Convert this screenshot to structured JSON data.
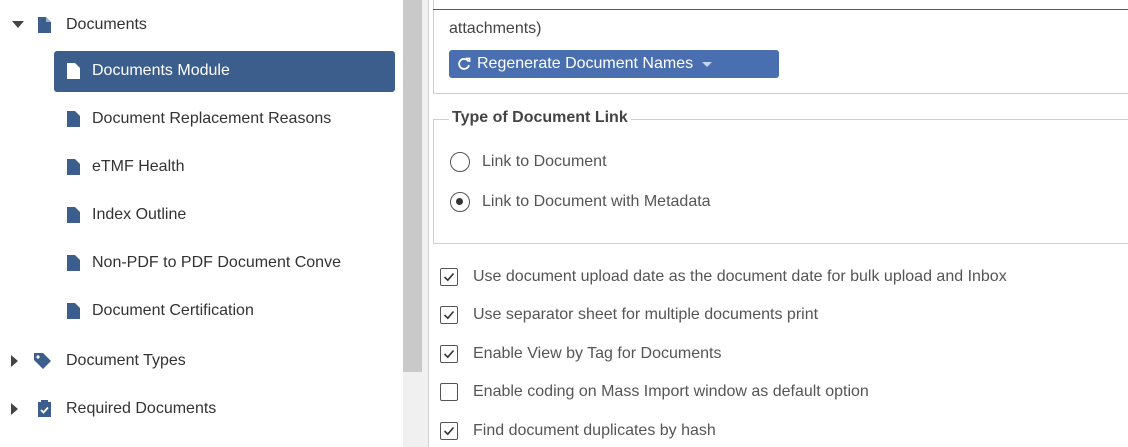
{
  "sidebar": {
    "items": [
      {
        "label": "Documents",
        "level": 0,
        "expanded": true
      },
      {
        "label": "Documents Module",
        "level": 1,
        "selected": true
      },
      {
        "label": "Document Replacement Reasons",
        "level": 1
      },
      {
        "label": "eTMF Health",
        "level": 1
      },
      {
        "label": "Index Outline",
        "level": 1
      },
      {
        "label": "Non-PDF to PDF Document Conve",
        "level": 1
      },
      {
        "label": "Document Certification",
        "level": 1
      },
      {
        "label": "Document Types",
        "level": 0,
        "expanded": false
      },
      {
        "label": "Required Documents",
        "level": 0,
        "expanded": false
      }
    ]
  },
  "main": {
    "attachments_text": "attachments)",
    "regenerate_button": "Regenerate Document Names",
    "document_link": {
      "legend": "Type of Document Link",
      "options": [
        {
          "label": "Link to Document",
          "selected": false
        },
        {
          "label": "Link to Document with Metadata",
          "selected": true
        }
      ]
    },
    "options": [
      {
        "label": "Use document upload date as the document date for bulk upload and Inbox",
        "checked": true
      },
      {
        "label": "Use separator sheet for multiple documents print",
        "checked": true
      },
      {
        "label": "Enable View by Tag for Documents",
        "checked": true
      },
      {
        "label": "Enable coding on Mass Import window as default option",
        "checked": false
      },
      {
        "label": "Find document duplicates by hash",
        "checked": true
      }
    ]
  },
  "colors": {
    "accent": "#3b5e8c",
    "button": "#4a6fb0"
  },
  "icons": {
    "file": "file-icon",
    "tag": "tag-icon",
    "clipboard": "clipboard-check-icon",
    "refresh": "refresh-icon"
  }
}
